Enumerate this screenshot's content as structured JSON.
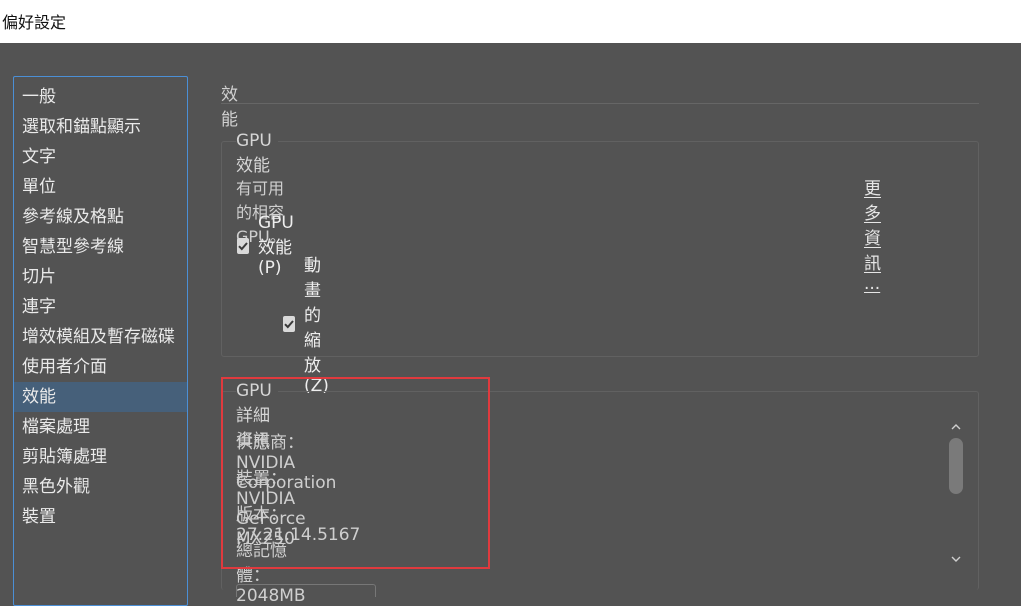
{
  "window": {
    "title": "偏好設定"
  },
  "sidebar": {
    "items": [
      {
        "label": "一般"
      },
      {
        "label": "選取和錨點顯示"
      },
      {
        "label": "文字"
      },
      {
        "label": "單位"
      },
      {
        "label": "參考線及格點"
      },
      {
        "label": "智慧型參考線"
      },
      {
        "label": "切片"
      },
      {
        "label": "連字"
      },
      {
        "label": "增效模組及暫存磁碟"
      },
      {
        "label": "使用者介面"
      },
      {
        "label": "效能"
      },
      {
        "label": "檔案處理"
      },
      {
        "label": "剪貼簿處理"
      },
      {
        "label": "黑色外觀"
      },
      {
        "label": "裝置"
      }
    ],
    "selected_index": 10
  },
  "main": {
    "section_title": "效能",
    "gpu_performance": {
      "legend": "GPU 效能",
      "availability_text": "有可用的相容 GPU。",
      "more_info_link": "更多資訊 ...",
      "gpu_checkbox": {
        "label": "GPU 效能 (P)",
        "checked": true
      },
      "animated_zoom_checkbox": {
        "label": "動畫的縮放 (Z)",
        "checked": true
      }
    },
    "gpu_details": {
      "legend": "GPU 詳細資訊",
      "vendor": "供應商：NVIDIA Corporation",
      "device": "裝置：NVIDIA GeForce MX250",
      "version": "版本：27.21.14.5167",
      "memory": "總記憶體：2048MB"
    }
  },
  "colors": {
    "background": "#535353",
    "sidebar_selected": "#46607a",
    "sidebar_border": "#4b8fd6",
    "highlight_box": "#e03a3e"
  }
}
